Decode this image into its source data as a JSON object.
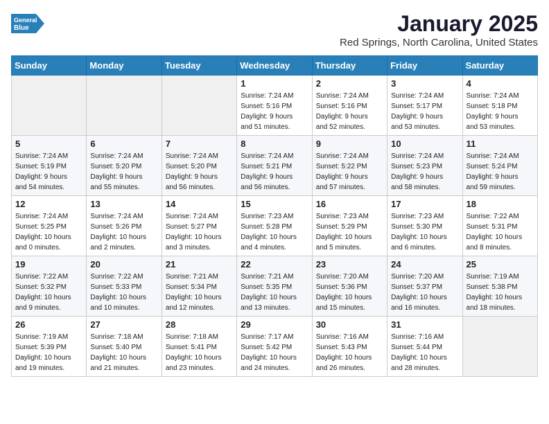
{
  "header": {
    "logo_general": "General",
    "logo_blue": "Blue",
    "month": "January 2025",
    "location": "Red Springs, North Carolina, United States"
  },
  "weekdays": [
    "Sunday",
    "Monday",
    "Tuesday",
    "Wednesday",
    "Thursday",
    "Friday",
    "Saturday"
  ],
  "weeks": [
    [
      {
        "day": "",
        "info": ""
      },
      {
        "day": "",
        "info": ""
      },
      {
        "day": "",
        "info": ""
      },
      {
        "day": "1",
        "info": "Sunrise: 7:24 AM\nSunset: 5:16 PM\nDaylight: 9 hours\nand 51 minutes."
      },
      {
        "day": "2",
        "info": "Sunrise: 7:24 AM\nSunset: 5:16 PM\nDaylight: 9 hours\nand 52 minutes."
      },
      {
        "day": "3",
        "info": "Sunrise: 7:24 AM\nSunset: 5:17 PM\nDaylight: 9 hours\nand 53 minutes."
      },
      {
        "day": "4",
        "info": "Sunrise: 7:24 AM\nSunset: 5:18 PM\nDaylight: 9 hours\nand 53 minutes."
      }
    ],
    [
      {
        "day": "5",
        "info": "Sunrise: 7:24 AM\nSunset: 5:19 PM\nDaylight: 9 hours\nand 54 minutes."
      },
      {
        "day": "6",
        "info": "Sunrise: 7:24 AM\nSunset: 5:20 PM\nDaylight: 9 hours\nand 55 minutes."
      },
      {
        "day": "7",
        "info": "Sunrise: 7:24 AM\nSunset: 5:20 PM\nDaylight: 9 hours\nand 56 minutes."
      },
      {
        "day": "8",
        "info": "Sunrise: 7:24 AM\nSunset: 5:21 PM\nDaylight: 9 hours\nand 56 minutes."
      },
      {
        "day": "9",
        "info": "Sunrise: 7:24 AM\nSunset: 5:22 PM\nDaylight: 9 hours\nand 57 minutes."
      },
      {
        "day": "10",
        "info": "Sunrise: 7:24 AM\nSunset: 5:23 PM\nDaylight: 9 hours\nand 58 minutes."
      },
      {
        "day": "11",
        "info": "Sunrise: 7:24 AM\nSunset: 5:24 PM\nDaylight: 9 hours\nand 59 minutes."
      }
    ],
    [
      {
        "day": "12",
        "info": "Sunrise: 7:24 AM\nSunset: 5:25 PM\nDaylight: 10 hours\nand 0 minutes."
      },
      {
        "day": "13",
        "info": "Sunrise: 7:24 AM\nSunset: 5:26 PM\nDaylight: 10 hours\nand 2 minutes."
      },
      {
        "day": "14",
        "info": "Sunrise: 7:24 AM\nSunset: 5:27 PM\nDaylight: 10 hours\nand 3 minutes."
      },
      {
        "day": "15",
        "info": "Sunrise: 7:23 AM\nSunset: 5:28 PM\nDaylight: 10 hours\nand 4 minutes."
      },
      {
        "day": "16",
        "info": "Sunrise: 7:23 AM\nSunset: 5:29 PM\nDaylight: 10 hours\nand 5 minutes."
      },
      {
        "day": "17",
        "info": "Sunrise: 7:23 AM\nSunset: 5:30 PM\nDaylight: 10 hours\nand 6 minutes."
      },
      {
        "day": "18",
        "info": "Sunrise: 7:22 AM\nSunset: 5:31 PM\nDaylight: 10 hours\nand 8 minutes."
      }
    ],
    [
      {
        "day": "19",
        "info": "Sunrise: 7:22 AM\nSunset: 5:32 PM\nDaylight: 10 hours\nand 9 minutes."
      },
      {
        "day": "20",
        "info": "Sunrise: 7:22 AM\nSunset: 5:33 PM\nDaylight: 10 hours\nand 10 minutes."
      },
      {
        "day": "21",
        "info": "Sunrise: 7:21 AM\nSunset: 5:34 PM\nDaylight: 10 hours\nand 12 minutes."
      },
      {
        "day": "22",
        "info": "Sunrise: 7:21 AM\nSunset: 5:35 PM\nDaylight: 10 hours\nand 13 minutes."
      },
      {
        "day": "23",
        "info": "Sunrise: 7:20 AM\nSunset: 5:36 PM\nDaylight: 10 hours\nand 15 minutes."
      },
      {
        "day": "24",
        "info": "Sunrise: 7:20 AM\nSunset: 5:37 PM\nDaylight: 10 hours\nand 16 minutes."
      },
      {
        "day": "25",
        "info": "Sunrise: 7:19 AM\nSunset: 5:38 PM\nDaylight: 10 hours\nand 18 minutes."
      }
    ],
    [
      {
        "day": "26",
        "info": "Sunrise: 7:19 AM\nSunset: 5:39 PM\nDaylight: 10 hours\nand 19 minutes."
      },
      {
        "day": "27",
        "info": "Sunrise: 7:18 AM\nSunset: 5:40 PM\nDaylight: 10 hours\nand 21 minutes."
      },
      {
        "day": "28",
        "info": "Sunrise: 7:18 AM\nSunset: 5:41 PM\nDaylight: 10 hours\nand 23 minutes."
      },
      {
        "day": "29",
        "info": "Sunrise: 7:17 AM\nSunset: 5:42 PM\nDaylight: 10 hours\nand 24 minutes."
      },
      {
        "day": "30",
        "info": "Sunrise: 7:16 AM\nSunset: 5:43 PM\nDaylight: 10 hours\nand 26 minutes."
      },
      {
        "day": "31",
        "info": "Sunrise: 7:16 AM\nSunset: 5:44 PM\nDaylight: 10 hours\nand 28 minutes."
      },
      {
        "day": "",
        "info": ""
      }
    ]
  ]
}
